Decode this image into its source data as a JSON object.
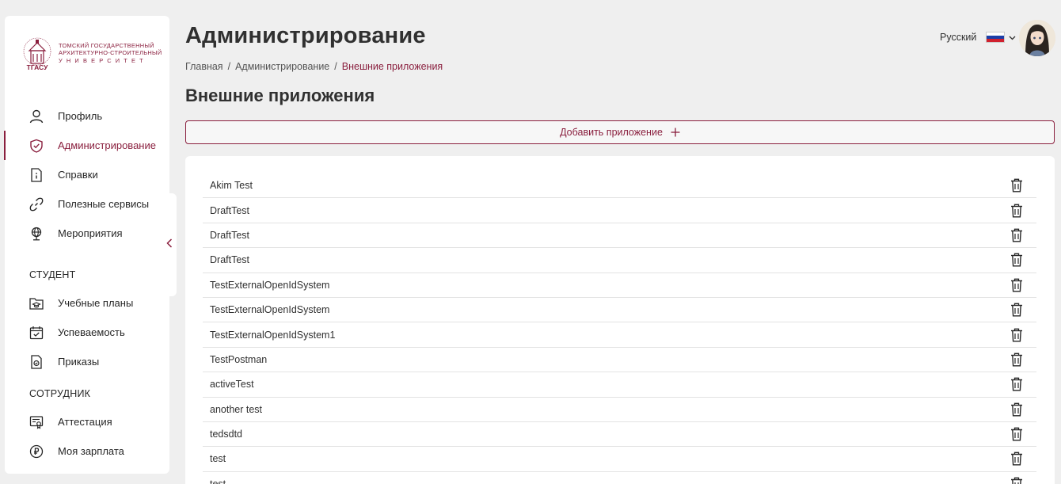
{
  "logo": {
    "line1": "ТОМСКИЙ ГОСУДАРСТВЕННЫЙ",
    "line2": "АРХИТЕКТУРНО-СТРОИТЕЛЬНЫЙ",
    "line3": "УНИВЕРСИТЕТ",
    "abbr": "ТГАСУ"
  },
  "sidebar": {
    "items": [
      {
        "label": "Профиль",
        "icon": "user-icon"
      },
      {
        "label": "Администрирование",
        "icon": "shield-check-icon"
      },
      {
        "label": "Справки",
        "icon": "info-document-icon"
      },
      {
        "label": "Полезные сервисы",
        "icon": "link-icon"
      },
      {
        "label": "Мероприятия",
        "icon": "globe-pin-icon"
      }
    ],
    "student_title": "СТУДЕНТ",
    "student_items": [
      {
        "label": "Учебные планы",
        "icon": "folder-cap-icon"
      },
      {
        "label": "Успеваемость",
        "icon": "calendar-check-icon"
      },
      {
        "label": "Приказы",
        "icon": "document-badge-icon"
      }
    ],
    "employee_title": "СОТРУДНИК",
    "employee_items": [
      {
        "label": "Аттестация",
        "icon": "certificate-icon"
      },
      {
        "label": "Моя зарплата",
        "icon": "ruble-icon"
      }
    ]
  },
  "header": {
    "title": "Администрирование",
    "breadcrumb": [
      "Главная",
      "Администрирование",
      "Внешние приложения"
    ],
    "breadcrumb_sep": "/",
    "language": "Русский"
  },
  "main": {
    "heading": "Внешние приложения",
    "add_button": "Добавить приложение",
    "apps": [
      "Akim Test",
      "DraftTest",
      "DraftTest",
      "DraftTest",
      "TestExternalOpenIdSystem",
      "TestExternalOpenIdSystem",
      "TestExternalOpenIdSystem1",
      "TestPostman",
      "activeTest",
      "another test",
      "tedsdtd",
      "test",
      "test"
    ]
  },
  "colors": {
    "accent": "#8a1f3e",
    "background": "#efefef",
    "card": "#ffffff"
  }
}
